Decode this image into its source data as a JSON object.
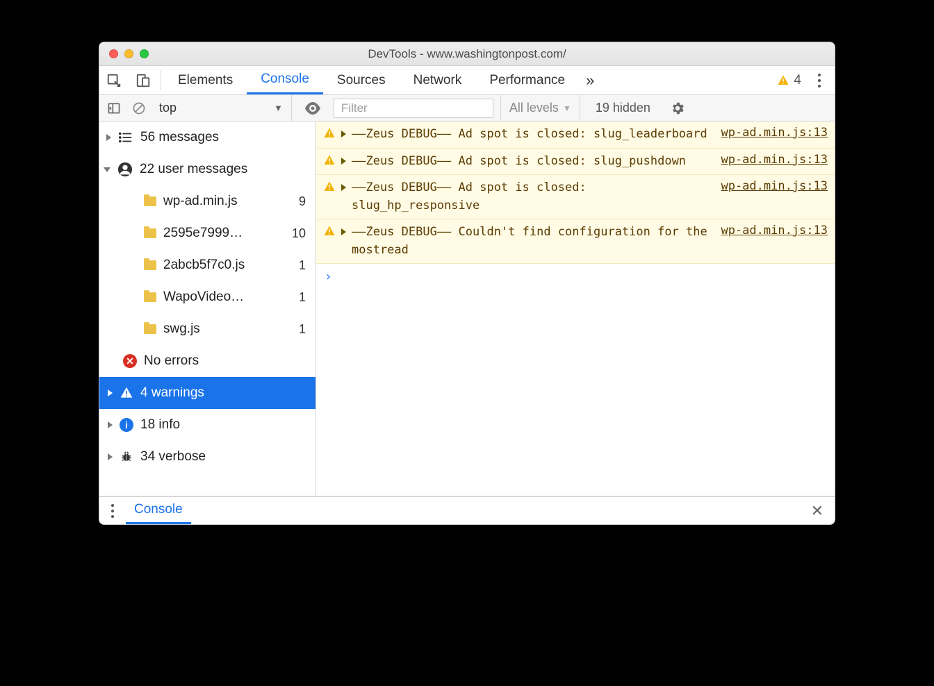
{
  "window": {
    "title": "DevTools - www.washingtonpost.com/"
  },
  "tabs": {
    "items": [
      "Elements",
      "Console",
      "Sources",
      "Network",
      "Performance"
    ],
    "active": "Console",
    "overflow_glyph": "»",
    "warning_count": "4"
  },
  "subbar": {
    "context": "top",
    "filter_placeholder": "Filter",
    "levels_label": "All levels",
    "hidden_label": "19 hidden"
  },
  "sidebar": {
    "messages": {
      "label": "56 messages"
    },
    "user_messages": {
      "label": "22 user messages"
    },
    "files": [
      {
        "name": "wp-ad.min.js",
        "count": "9"
      },
      {
        "name": "2595e7999…",
        "count": "10"
      },
      {
        "name": "2abcb5f7c0.js",
        "count": "1"
      },
      {
        "name": "WapoVideo…",
        "count": "1"
      },
      {
        "name": "swg.js",
        "count": "1"
      }
    ],
    "errors": {
      "label": "No errors"
    },
    "warnings": {
      "label": "4 warnings"
    },
    "info": {
      "label": "18 info"
    },
    "verbose": {
      "label": "34 verbose"
    }
  },
  "messages": [
    {
      "text": "––Zeus DEBUG–– Ad spot is closed: slug_leaderboard",
      "source": "wp-ad.min.js:13"
    },
    {
      "text": "––Zeus DEBUG–– Ad spot is closed: slug_pushdown",
      "source": "wp-ad.min.js:13"
    },
    {
      "text": "––Zeus DEBUG–– Ad spot is closed: slug_hp_responsive",
      "source": "wp-ad.min.js:13"
    },
    {
      "text": "––Zeus DEBUG–– Couldn't find configuration for the mostread",
      "source": "wp-ad.min.js:13"
    }
  ],
  "prompt_glyph": "›",
  "drawer": {
    "tab": "Console",
    "close_glyph": "✕"
  }
}
